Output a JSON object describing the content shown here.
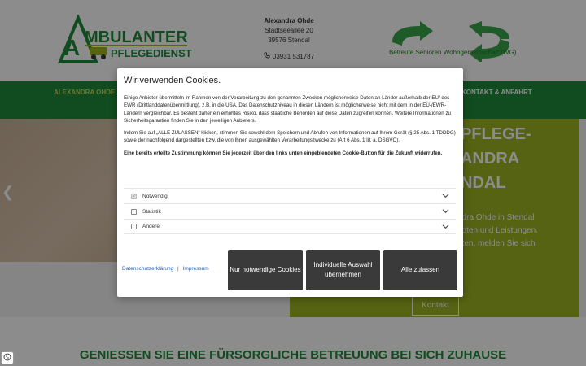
{
  "header": {
    "logo_text_line1": "MBULANTER",
    "logo_text_line2": "PFLEGEDIENST",
    "logo_big_letter": "A",
    "contact": {
      "name": "Alexandra Ohde",
      "street": "Stadtseeallee 20",
      "city": "39576 Stendal",
      "phone": "03931 531787"
    },
    "association_text": "Betreute Senioren Wohngemeinschaft (WG)"
  },
  "nav": {
    "left_item": "ALEXANDRA OHDE",
    "right_item": "KONTAKT & ANFAHRT"
  },
  "hero": {
    "heading": "PFLEGE-\nANDRA\nNDAL",
    "text": "ndra Ohde in Stendal\nboten und Leistungen.\nhten, melden Sie sich",
    "button_label": "Kontakt"
  },
  "bottom_title": "GENIESSEN SIE EINE FÜRSORGLICHE BETREUUNG BEI SICH ZUHAUSE",
  "cookie_modal": {
    "title": "Wir verwenden Cookies.",
    "paragraph1": "Einige Anbieter übermitteln im Rahmen von der Verarbeitung zu den genannten Zwecken möglicherweise Daten an Länder außerhalb der EU/ des EWR (Drittlanddatenübermittlung), z.B. in die USA. Das Datenschutzniveau in diesen Ländern ist möglicherweise nicht mit dem in der EU-/EWR-Ländern vergleichbar. Es besteht daher ein erhöhtes Risiko, dass staatliche Behörden auf diese Daten zugreifen können. Weitere Informationen zu Sicherheitsgarantien finden Sie in den jeweiligen Anbieters.",
    "paragraph2": "Indem Sie auf „ALLE ZULASSEN“ klicken, stimmen Sie sowohl dem Speichern und Abrufen von Informationen auf Ihrem Gerät (§ 25 Abs. 1 TDDDG) sowie der nachfolgend dargestellten bzw. die von Ihnen ausgewählten Verarbeitungszwecke zu (Art 6 Abs. 1 lit. a. DSGVO).",
    "paragraph3": "Eine bereits erteilte Zustimmung können Sie jederzeit über den links unten eingeblendeten Cookie-Button für die Zukunft widerrufen.",
    "options": [
      {
        "label": "Notwendig",
        "checked": true,
        "disabled": true
      },
      {
        "label": "Statistik",
        "checked": false,
        "disabled": false
      },
      {
        "label": "Andere",
        "checked": false,
        "disabled": false
      }
    ],
    "link_privacy": "Datenschutzerklärung",
    "link_separator": "|",
    "link_imprint": "Impressum",
    "btn_necessary": "Nur notwendige Cookies",
    "btn_individual": "Individuelle Auswahl übernehmen",
    "btn_all": "Alle zulassen"
  },
  "colors": {
    "brand_green": "#1e8b3a",
    "hero_lime": "#9bb521",
    "button_dark": "#3a3a3a",
    "link_blue": "#2a5db0"
  }
}
